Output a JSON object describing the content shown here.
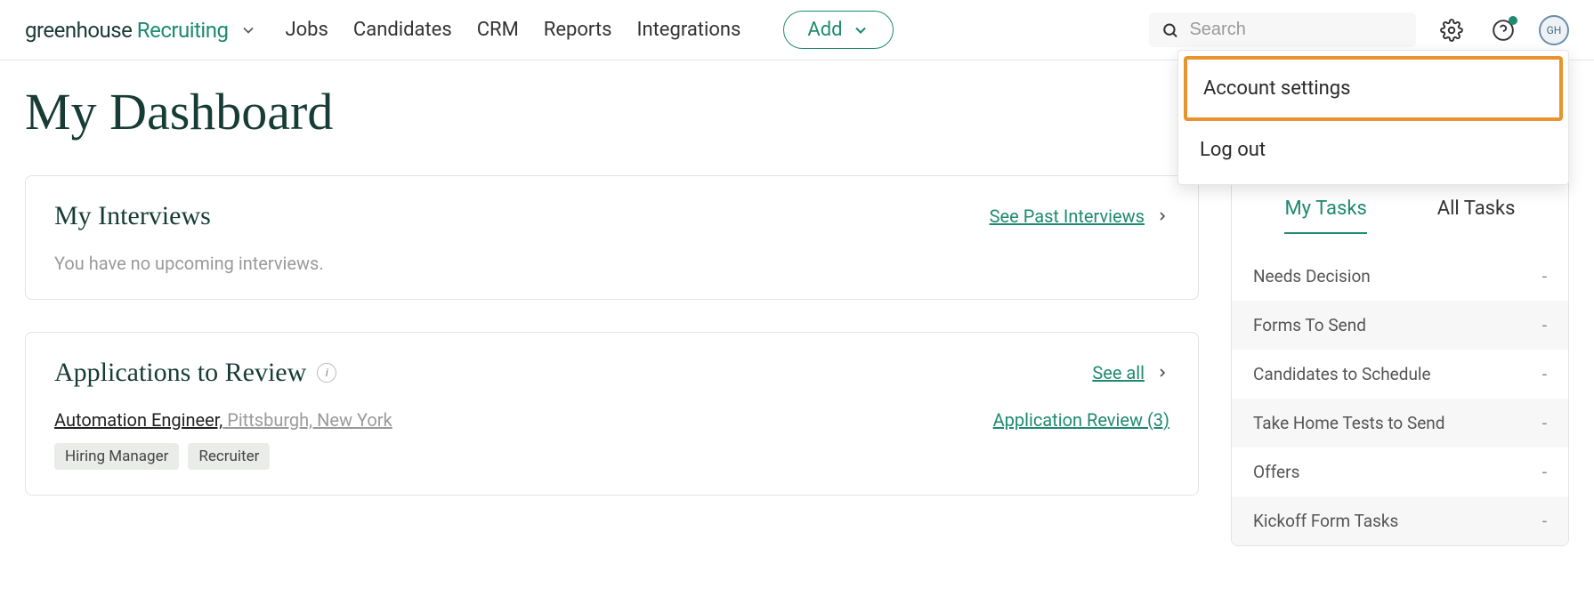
{
  "brand": {
    "part1": "greenhouse ",
    "part2": "Recruiting"
  },
  "nav": {
    "jobs": "Jobs",
    "candidates": "Candidates",
    "crm": "CRM",
    "reports": "Reports",
    "integrations": "Integrations"
  },
  "add_label": "Add",
  "search": {
    "placeholder": "Search"
  },
  "avatar_initials": "GH",
  "dropdown": {
    "account_settings": "Account settings",
    "log_out": "Log out"
  },
  "page_title": "My Dashboard",
  "interviews": {
    "title": "My Interviews",
    "see_past": "See Past Interviews",
    "empty": "You have no upcoming interviews."
  },
  "applications": {
    "title": "Applications to Review",
    "see_all": "See all",
    "job": "Automation Engineer,",
    "location": " Pittsburgh, New York",
    "review_link": "Application Review (3)",
    "tags": [
      "Hiring Manager",
      "Recruiter"
    ]
  },
  "tasks": {
    "tab_my": "My Tasks",
    "tab_all": "All Tasks",
    "rows": [
      {
        "label": "Needs Decision",
        "value": "-"
      },
      {
        "label": "Forms To Send",
        "value": "-"
      },
      {
        "label": "Candidates to Schedule",
        "value": "-"
      },
      {
        "label": "Take Home Tests to Send",
        "value": "-"
      },
      {
        "label": "Offers",
        "value": "-"
      },
      {
        "label": "Kickoff Form Tasks",
        "value": "-"
      }
    ]
  }
}
